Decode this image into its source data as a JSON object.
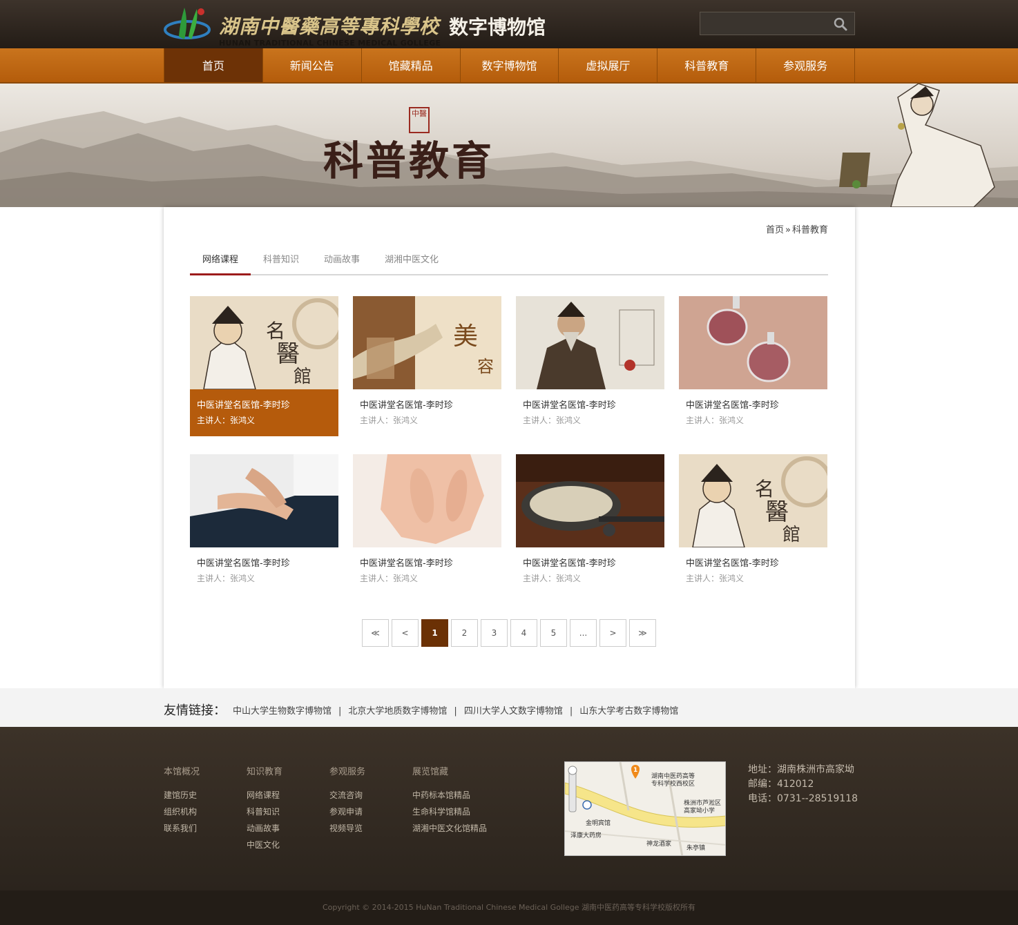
{
  "header": {
    "school_name": "湖南中醫藥高等專科學校",
    "school_name_en": "HUNAN TRADITIONAL CHINESE MEDICAL GOLLEGE",
    "site_title": "数字博物馆",
    "search_placeholder": ""
  },
  "nav": {
    "items": [
      {
        "label": "首页",
        "active": true
      },
      {
        "label": "新闻公告"
      },
      {
        "label": "馆藏精品"
      },
      {
        "label": "数字博物馆"
      },
      {
        "label": "虚拟展厅"
      },
      {
        "label": "科普教育"
      },
      {
        "label": "参观服务"
      }
    ]
  },
  "banner": {
    "title": "科普教育",
    "seal": "中醫"
  },
  "breadcrumb": {
    "home": "首页",
    "separator": "»",
    "current": "科普教育"
  },
  "tabs": [
    {
      "label": "网络课程",
      "active": true
    },
    {
      "label": "科普知识"
    },
    {
      "label": "动画故事"
    },
    {
      "label": "湖湘中医文化"
    }
  ],
  "cards": [
    {
      "title": "中医讲堂名医馆-李时珍",
      "speaker": "主讲人：张鸿义",
      "thumb": "mingyiguan-icon",
      "active": true
    },
    {
      "title": "中医讲堂名医馆-李时珍",
      "speaker": "主讲人：张鸿义",
      "thumb": "meirong-icon"
    },
    {
      "title": "中医讲堂名医馆-李时珍",
      "speaker": "主讲人：张鸿义",
      "thumb": "ancient-doctor-icon"
    },
    {
      "title": "中医讲堂名医馆-李时珍",
      "speaker": "主讲人：张鸿义",
      "thumb": "cupping-icon"
    },
    {
      "title": "中医讲堂名医馆-李时珍",
      "speaker": "主讲人：张鸿义",
      "thumb": "pulse-diagnosis-icon"
    },
    {
      "title": "中医讲堂名医馆-李时珍",
      "speaker": "主讲人：张鸿义",
      "thumb": "foot-massage-icon"
    },
    {
      "title": "中医讲堂名医馆-李时珍",
      "speaker": "主讲人：张鸿义",
      "thumb": "herbs-icon"
    },
    {
      "title": "中医讲堂名医馆-李时珍",
      "speaker": "主讲人：张鸿义",
      "thumb": "mingyiguan-icon"
    }
  ],
  "pager": {
    "first": "≪",
    "prev": "<",
    "pages": [
      "1",
      "2",
      "3",
      "4",
      "5",
      "..."
    ],
    "current": "1",
    "next": ">",
    "last": "≫"
  },
  "links": {
    "label": "友情链接：",
    "items": [
      "中山大学生物数字博物馆",
      "北京大学地质数字博物馆",
      "四川大学人文数字博物馆",
      "山东大学考古数字博物馆"
    ],
    "separator": "|"
  },
  "footer": {
    "columns": [
      {
        "heading": "本馆概况",
        "items": [
          "建馆历史",
          "组织机构",
          "联系我们"
        ]
      },
      {
        "heading": "知识教育",
        "items": [
          "网络课程",
          "科普知识",
          "动画故事",
          "中医文化"
        ]
      },
      {
        "heading": "参观服务",
        "items": [
          "交流咨询",
          "参观申请",
          "视频导览"
        ]
      },
      {
        "heading": "展览馆藏",
        "items": [
          "中药标本馆精品",
          "生命科学馆精品",
          "湖湘中医文化馆精品"
        ]
      }
    ],
    "map": {
      "marker_label": "1",
      "label_main": "湖南中医药高等\n专科学校西校区",
      "label_school": "株洲市芦淞区\n高家坳小学",
      "label_hotel": "金明宾馆",
      "label_pharmacy": "泽康大药房",
      "label_restaurant": "神龙酒家",
      "label_town": "朱亭镇"
    },
    "address": "地址：湖南株洲市高家坳",
    "postcode": "邮编：412012",
    "phone": "电话：0731--28519118",
    "copyright": "Copyright © 2014-2015 HuNan Traditional Chinese Medical Gollege 湖南中医药高等专科学校版权所有"
  },
  "colors": {
    "nav_orange": "#c06a14",
    "nav_active": "#6d3206",
    "card_active": "#b55b0c",
    "tab_underline": "#9c1b1b",
    "footer_bg": "#3c3228"
  }
}
